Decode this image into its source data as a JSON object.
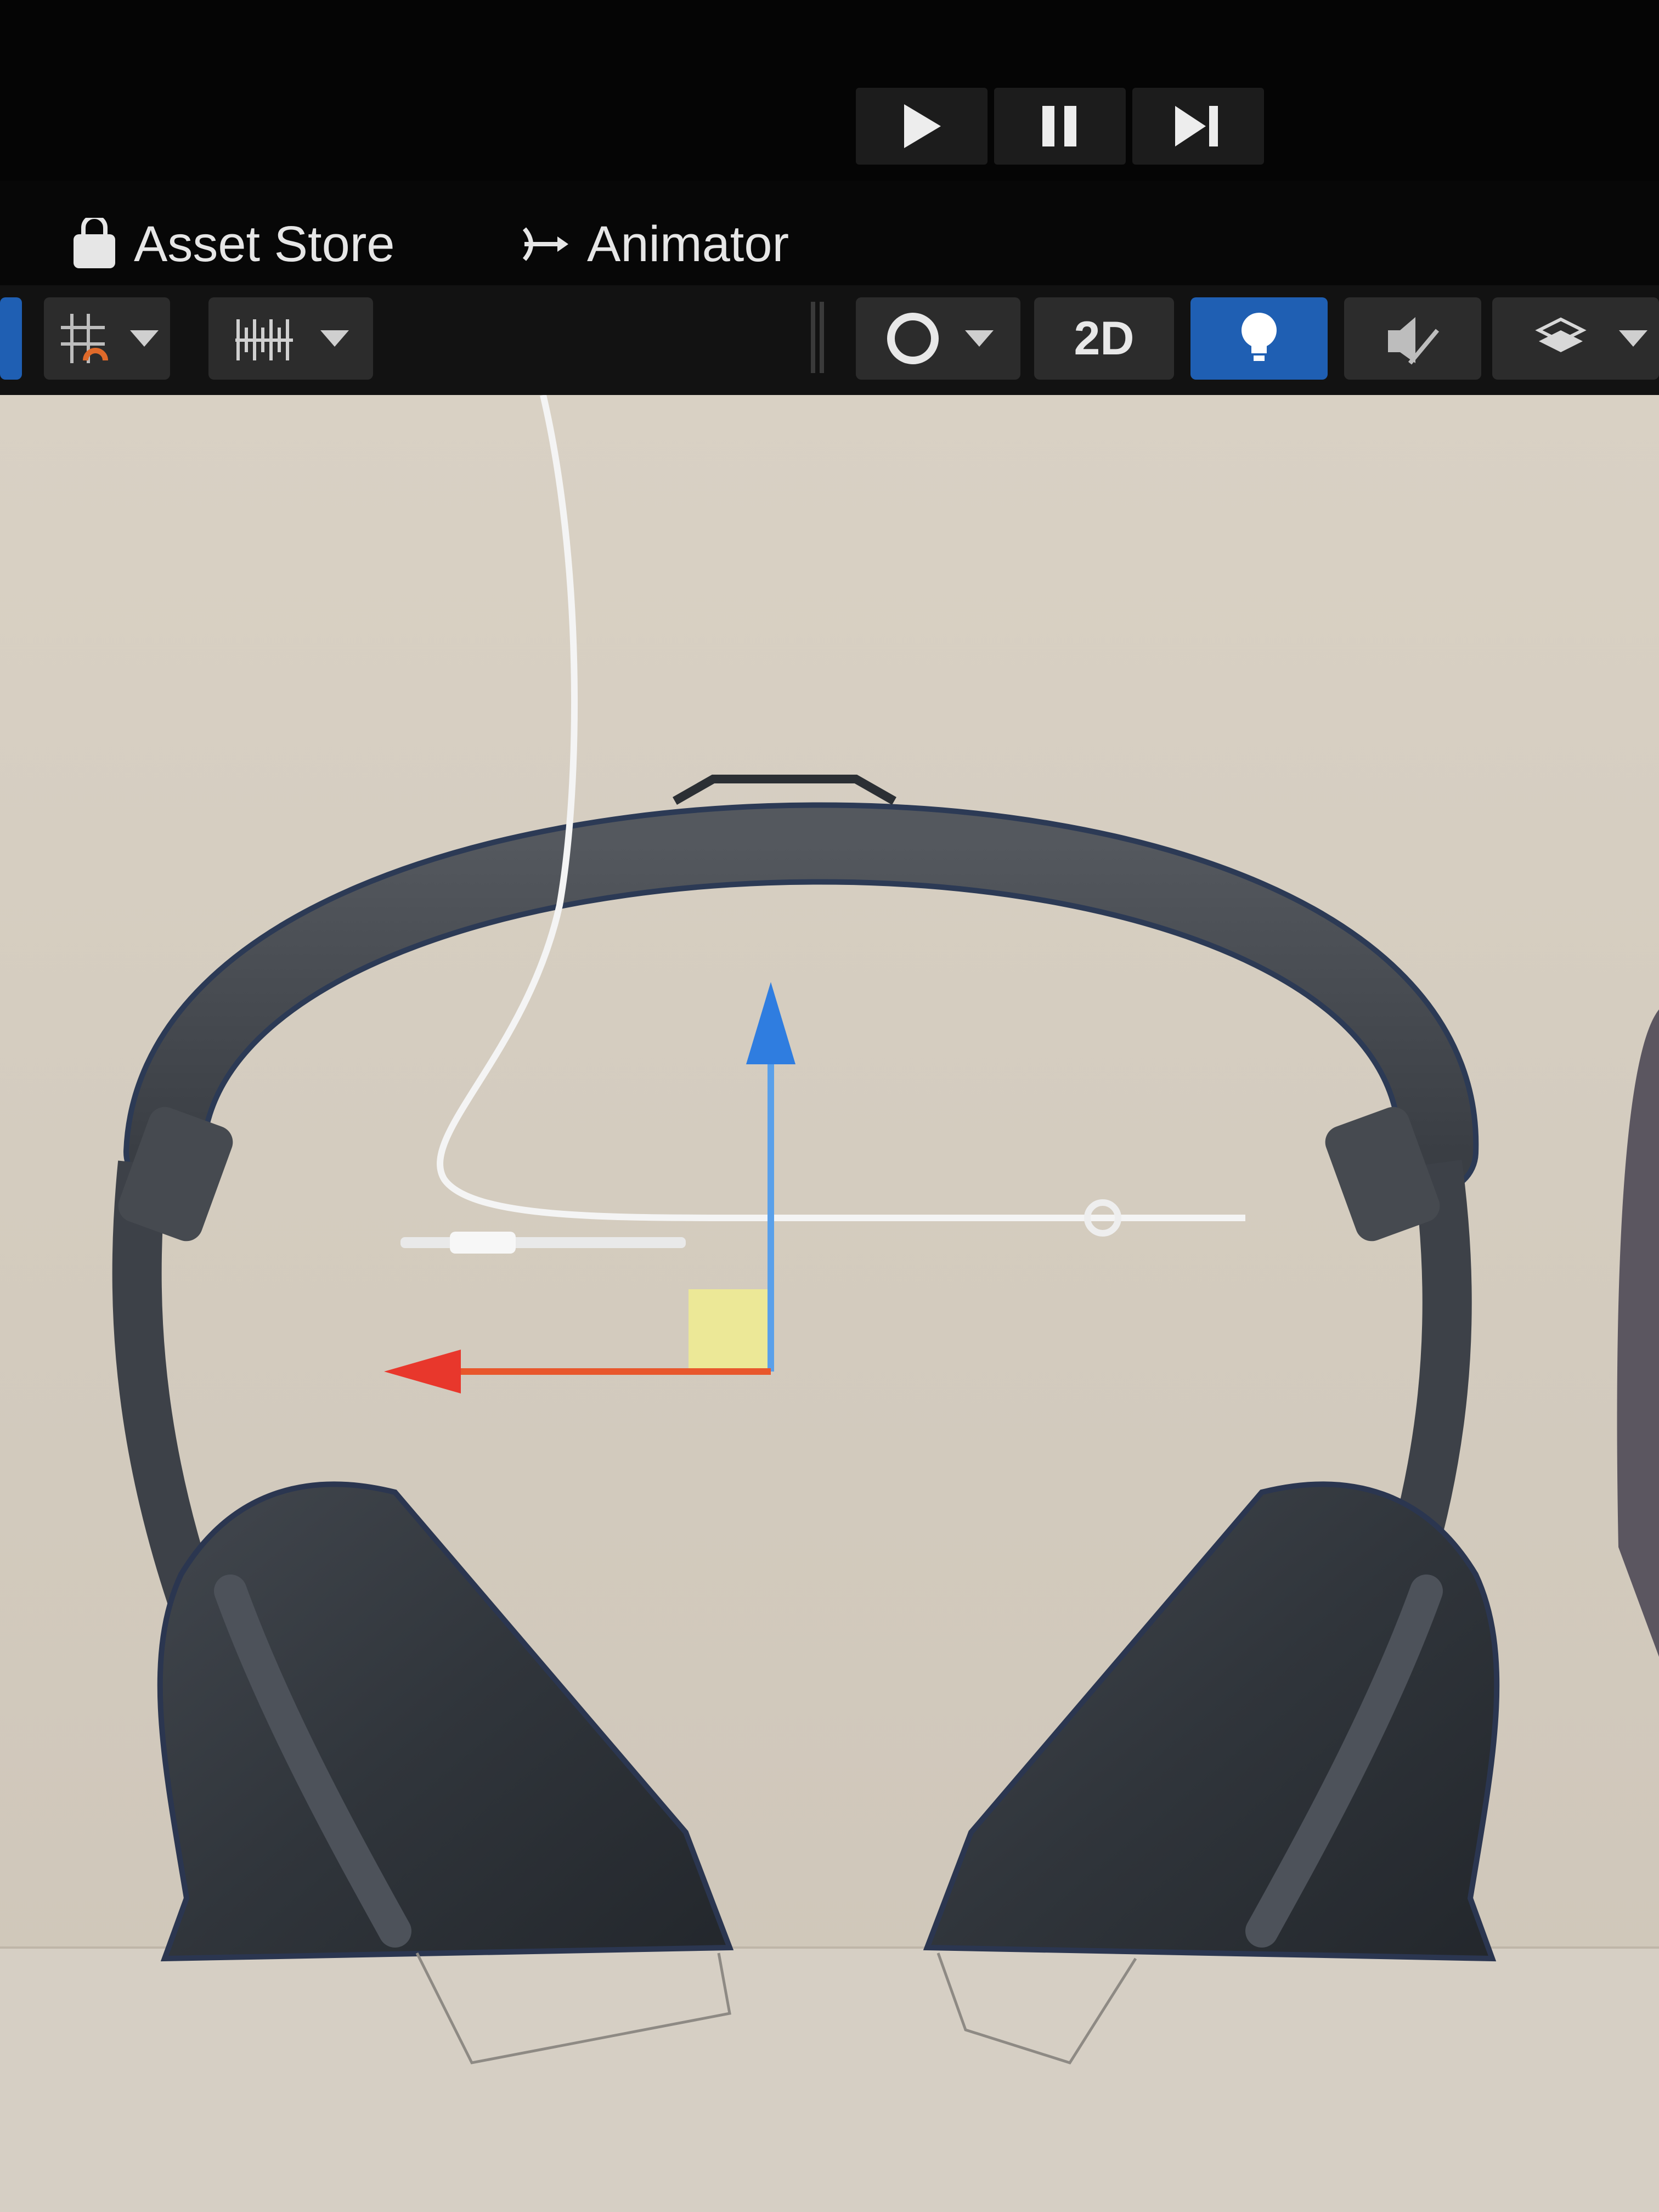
{
  "play_controls": {
    "play": "play-icon",
    "pause": "pause-icon",
    "step": "step-forward-icon"
  },
  "tabs": {
    "asset_store": {
      "label": "Asset Store",
      "icon": "shopping-bag-icon"
    },
    "animator": {
      "label": "Animator",
      "icon": "animator-icon"
    }
  },
  "scene_toolbar": {
    "toggle_2d_label": "2D",
    "lighting_active": true,
    "tools": [
      "grid-snap-icon",
      "increment-snap-icon",
      "shading-mode-icon",
      "lighting-icon",
      "audio-icon",
      "effects-icon"
    ]
  },
  "scene": {
    "object": "headphones-model",
    "gizmo": [
      "x-axis-handle-red",
      "y-axis-handle-blue",
      "xy-plane-handle-yellow"
    ],
    "colors": {
      "x_axis": "#e8372c",
      "y_axis": "#2f7de0",
      "plane": "#f4f18a",
      "selected_toolbar": "#1f5fb3"
    }
  }
}
